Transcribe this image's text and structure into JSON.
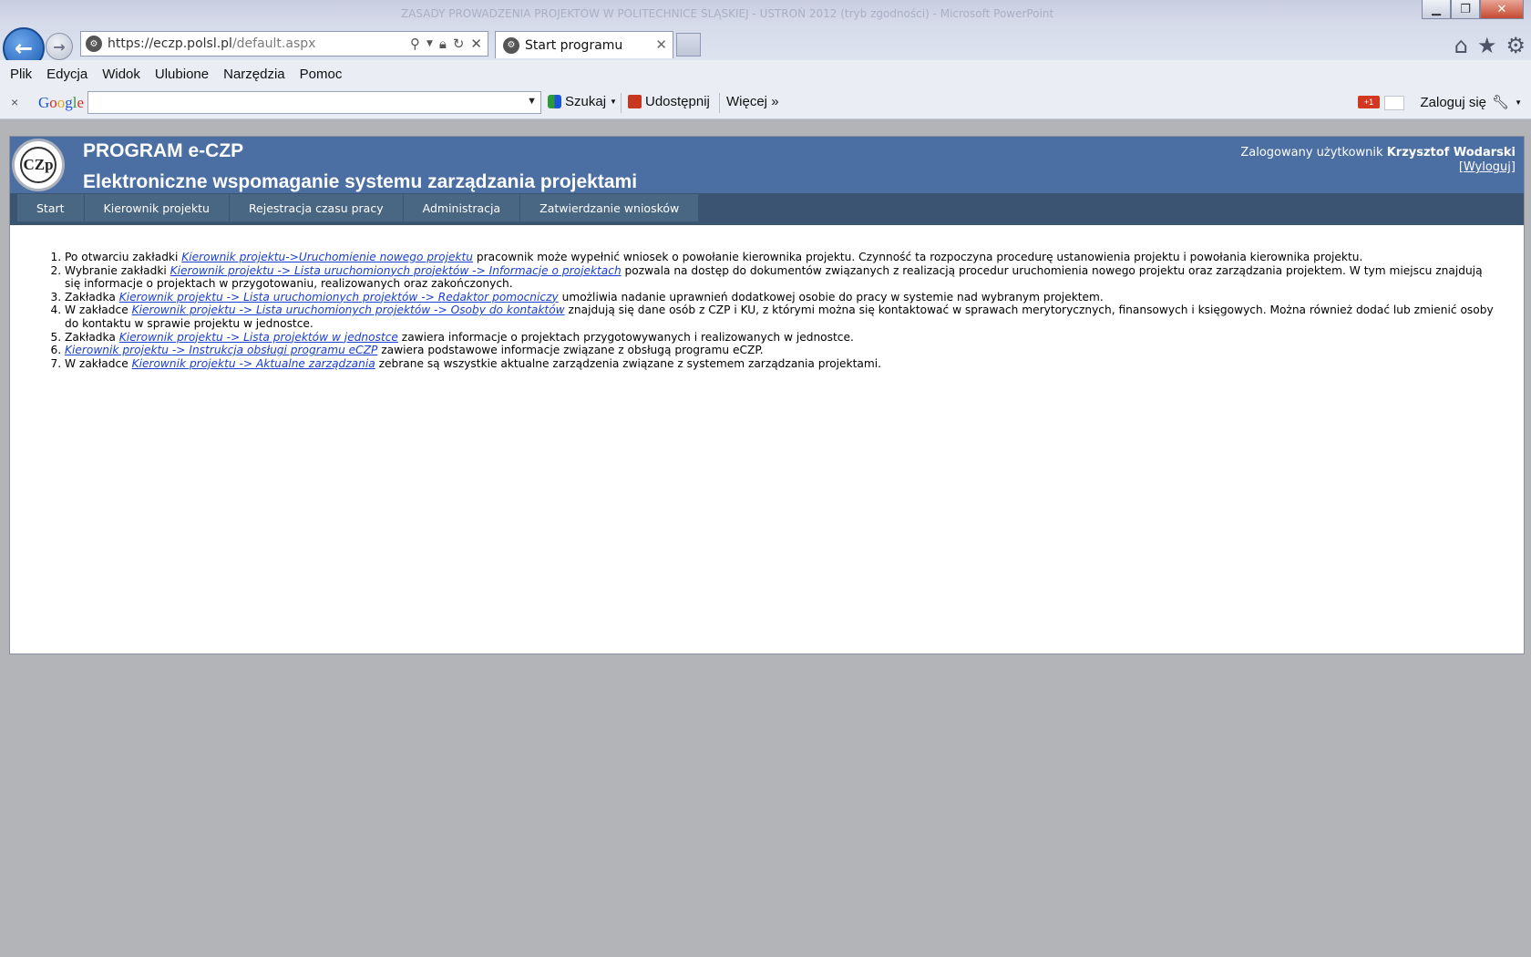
{
  "browser": {
    "url_host": "https://eczp.polsl.pl",
    "url_path": "/default.aspx",
    "tab_title": "Start programu",
    "tab_close": "✕",
    "window_title_ghost": "ZASADY PROWADZENIA PROJEKTÓW W POLITECHNICE ŚLĄSKIEJ - USTROŃ 2012 (tryb zgodności) - Microsoft PowerPoint"
  },
  "menu": {
    "items": [
      "Plik",
      "Edycja",
      "Widok",
      "Ulubione",
      "Narzędzia",
      "Pomoc"
    ]
  },
  "google_toolbar": {
    "close": "×",
    "logo": "Google",
    "search_value": "",
    "search_label": "Szukaj",
    "share_label": "Udostępnij",
    "more_label": "Więcej",
    "login_label": "Zaloguj się",
    "plus_label": "+1"
  },
  "app": {
    "logo_text": "CZp",
    "title": "PROGRAM e-CZP",
    "subtitle": "Elektroniczne wspomaganie systemu zarządzania projektami",
    "user_prefix": "Zalogowany użytkownik",
    "user_name": "Krzysztof Wodarski",
    "logout_label": "Wyloguj",
    "nav": [
      "Start",
      "Kierownik projektu",
      "Rejestracja czasu pracy",
      "Administracja",
      "Zatwierdzanie wniosków"
    ]
  },
  "content": {
    "items": [
      {
        "pre": "Po otwarciu zakładki ",
        "link": "Kierownik projektu->Uruchomienie nowego projektu",
        "post": " pracownik może wypełnić wniosek o powołanie kierownika projektu. Czynność ta rozpoczyna procedurę ustanowienia projektu i powołania kierownika projektu."
      },
      {
        "pre": "Wybranie zakładki ",
        "link": "Kierownik projektu -> Lista uruchomionych projektów -> Informacje o projektach",
        "post": " pozwala na dostęp do dokumentów związanych z realizacją procedur uruchomienia nowego projektu oraz zarządzania projektem. W tym miejscu znajdują się informacje o projektach w przygotowaniu, realizowanych oraz zakończonych."
      },
      {
        "pre": "Zakładka ",
        "link": "Kierownik projektu -> Lista uruchomionych projektów -> Redaktor pomocniczy",
        "post": " umożliwia nadanie uprawnień dodatkowej osobie do pracy w systemie nad wybranym projektem."
      },
      {
        "pre": "W zakładce ",
        "link": "Kierownik projektu -> Lista uruchomionych projektów -> Osoby do kontaktów",
        "post": " znajdują się dane osób z CZP i KU, z którymi można się kontaktować w sprawach merytorycznych, finansowych i księgowych. Można również dodać lub zmienić osoby do kontaktu w sprawie projektu w jednostce."
      },
      {
        "pre": "Zakładka ",
        "link": "Kierownik projektu -> Lista projektów w jednostce",
        "post": " zawiera informacje o projektach przygotowywanych i realizowanych w jednostce."
      },
      {
        "pre": "",
        "link": "Kierownik projektu -> Instrukcja obsługi programu eCZP",
        "post": " zawiera podstawowe informacje związane z obsługą programu eCZP."
      },
      {
        "pre": "W zakładce ",
        "link": "Kierownik projektu -> Aktualne zarządzania",
        "post": " zebrane są wszystkie aktualne zarządzenia związane z systemem zarządzania projektami."
      }
    ]
  }
}
